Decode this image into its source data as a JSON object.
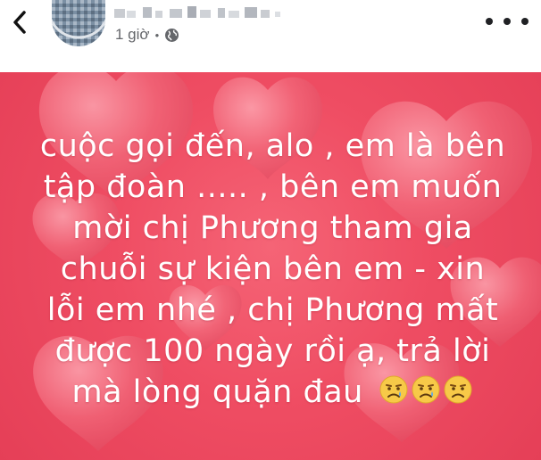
{
  "header": {
    "author_name": "",
    "timestamp": "1 giờ",
    "privacy_icon": "globe-icon",
    "back_icon": "chevron-left-icon",
    "more_icon": "more-horizontal-icon"
  },
  "post": {
    "background_color": "#ef4d63",
    "text_lines": [
      "cuộc gọi đến, alo , em là bên",
      "tập đoàn ..... , bên em muốn",
      "mời chị Phương tham gia",
      "chuỗi sự kiện bên em - xin",
      "lỗi em nhé , chị Phương mất",
      "được 100 ngày rồi ạ, trả lời",
      "mà lòng quặn đau"
    ],
    "emojis": [
      "sad-crying-face-emoji",
      "sad-crying-face-emoji",
      "sad-crying-face-emoji"
    ]
  }
}
